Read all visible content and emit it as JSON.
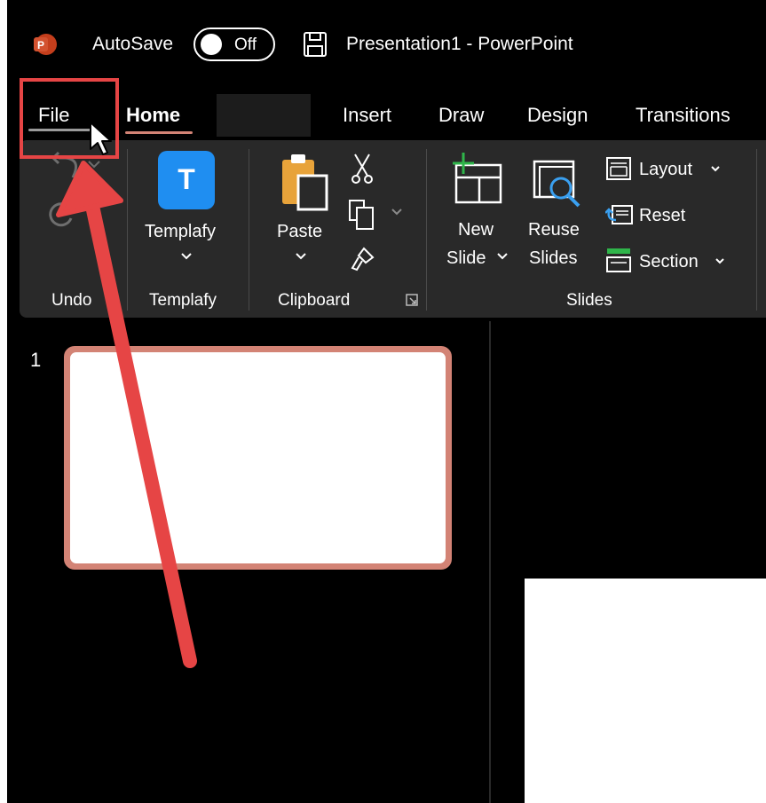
{
  "app": {
    "logo_letter": "P",
    "autosave_label": "AutoSave",
    "autosave_state": "Off",
    "document_title": "Presentation1  -  PowerPoint"
  },
  "tabs": [
    {
      "label": "File"
    },
    {
      "label": "Home",
      "active": true
    },
    {
      "label": "Insert"
    },
    {
      "label": "Draw"
    },
    {
      "label": "Design"
    },
    {
      "label": "Transitions"
    }
  ],
  "ribbon": {
    "templafy_label": "Templafy",
    "templafy_icon_letter": "T",
    "paste_label": "Paste",
    "new_slide_line1": "New",
    "new_slide_line2": "Slide",
    "reuse_line1": "Reuse",
    "reuse_line2": "Slides",
    "layout_label": "Layout",
    "reset_label": "Reset",
    "section_label": "Section",
    "groups": {
      "undo": "Undo",
      "templafy": "Templafy",
      "clipboard": "Clipboard",
      "slides": "Slides"
    }
  },
  "slides_panel": {
    "slide_number": "1"
  },
  "colors": {
    "background": "#000000",
    "ribbon": "#292929",
    "accent_powerpoint": "#c43e1c",
    "active_tab_underline": "#d38375",
    "templafy_blue": "#1f8ef1",
    "annotation_red": "#e64545"
  }
}
